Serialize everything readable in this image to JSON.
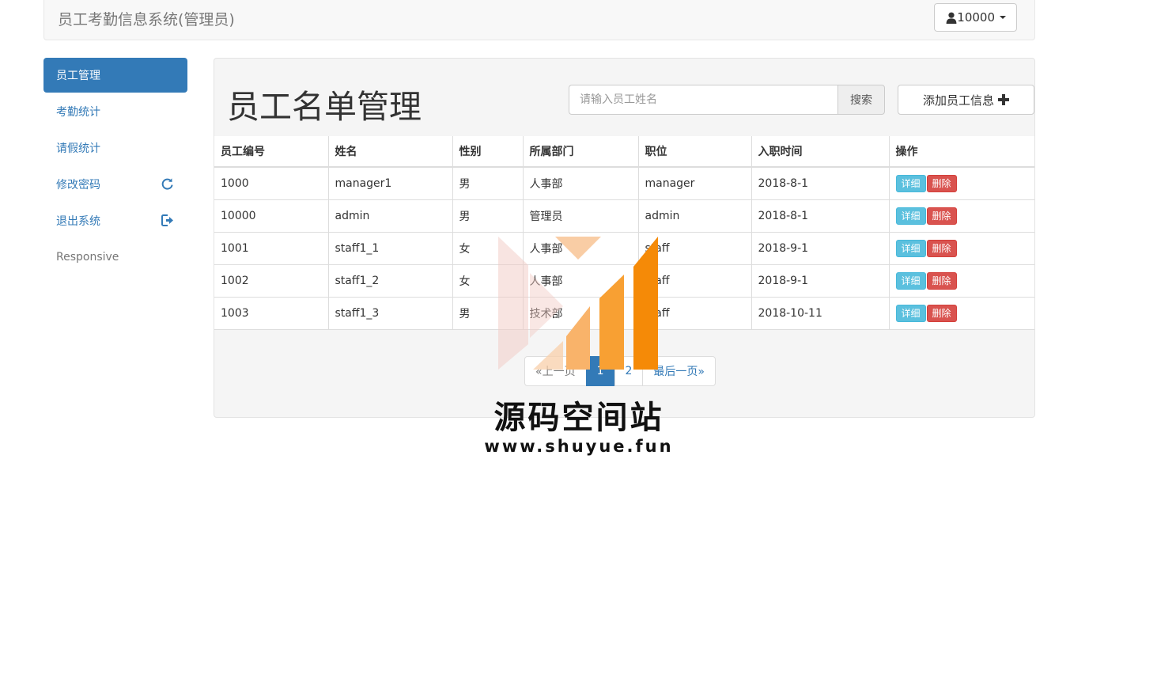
{
  "navbar": {
    "brand": "员工考勤信息系统(管理员)",
    "user_label": "10000"
  },
  "sidebar": {
    "items": [
      {
        "label": "员工管理",
        "active": true
      },
      {
        "label": "考勤统计"
      },
      {
        "label": "请假统计"
      },
      {
        "label": "修改密码",
        "icon": "refresh-icon"
      },
      {
        "label": "退出系统",
        "icon": "logout-icon"
      },
      {
        "label": "Responsive"
      }
    ]
  },
  "main": {
    "title": "员工名单管理",
    "search_placeholder": "请输入员工姓名",
    "search_button": "搜索",
    "add_button": "添加员工信息",
    "add_icon": "plus-icon",
    "table": {
      "headers": [
        "员工编号",
        "姓名",
        "性别",
        "所属部门",
        "职位",
        "入职时间",
        "操作"
      ],
      "rows": [
        [
          "1000",
          "manager1",
          "男",
          "人事部",
          "manager",
          "2018-8-1"
        ],
        [
          "10000",
          "admin",
          "男",
          "管理员",
          "admin",
          "2018-8-1"
        ],
        [
          "1001",
          "staff1_1",
          "女",
          "人事部",
          "staff",
          "2018-9-1"
        ],
        [
          "1002",
          "staff1_2",
          "女",
          "人事部",
          "staff",
          "2018-9-1"
        ],
        [
          "1003",
          "staff1_3",
          "男",
          "技术部",
          "staff",
          "2018-10-11"
        ]
      ],
      "actions": {
        "detail": "详细",
        "delete": "删除"
      }
    },
    "pagination": {
      "prev": "«上一页",
      "pages": [
        "1",
        "2"
      ],
      "current": "1",
      "last": "最后一页»"
    }
  },
  "watermark": {
    "title": "源码空间站",
    "url": "www.shuyue.fun"
  },
  "colors": {
    "primary": "#337ab7",
    "info": "#5bc0de",
    "danger": "#d9534f",
    "watermark_orange": "#f58a07"
  }
}
